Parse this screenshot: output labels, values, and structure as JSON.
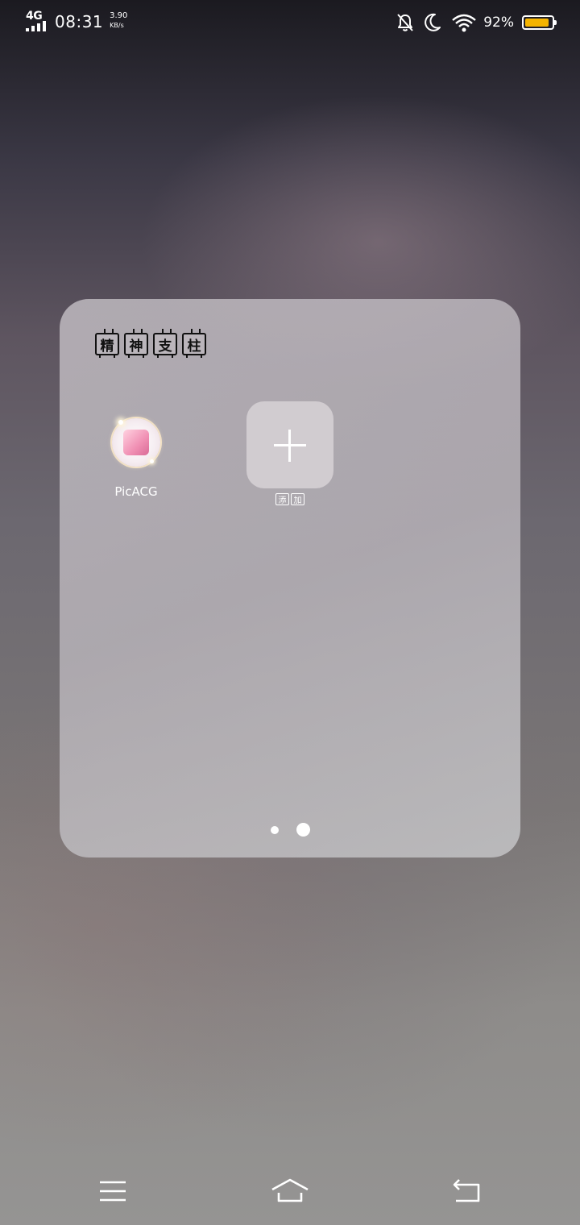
{
  "status_bar": {
    "network_type": "4G",
    "time": "08:31",
    "speed_value": "3.90",
    "speed_unit": "KB/s",
    "icons": [
      "signal-icon",
      "bell-off-icon",
      "moon-icon",
      "wifi-icon"
    ],
    "battery_percent_text": "92%",
    "battery_level": 0.92,
    "battery_color": "#f5b400"
  },
  "folder": {
    "title_chars": [
      "精",
      "神",
      "支",
      "柱"
    ],
    "apps": [
      {
        "label": "PicACG",
        "icon": "picacg-app-icon"
      }
    ],
    "add_tile": {
      "label_chars": [
        "添",
        "加"
      ],
      "icon": "plus-icon"
    },
    "pages": {
      "count": 2,
      "current": 2
    }
  },
  "nav_bar": {
    "buttons": [
      "menu-icon",
      "home-icon",
      "back-icon"
    ]
  }
}
